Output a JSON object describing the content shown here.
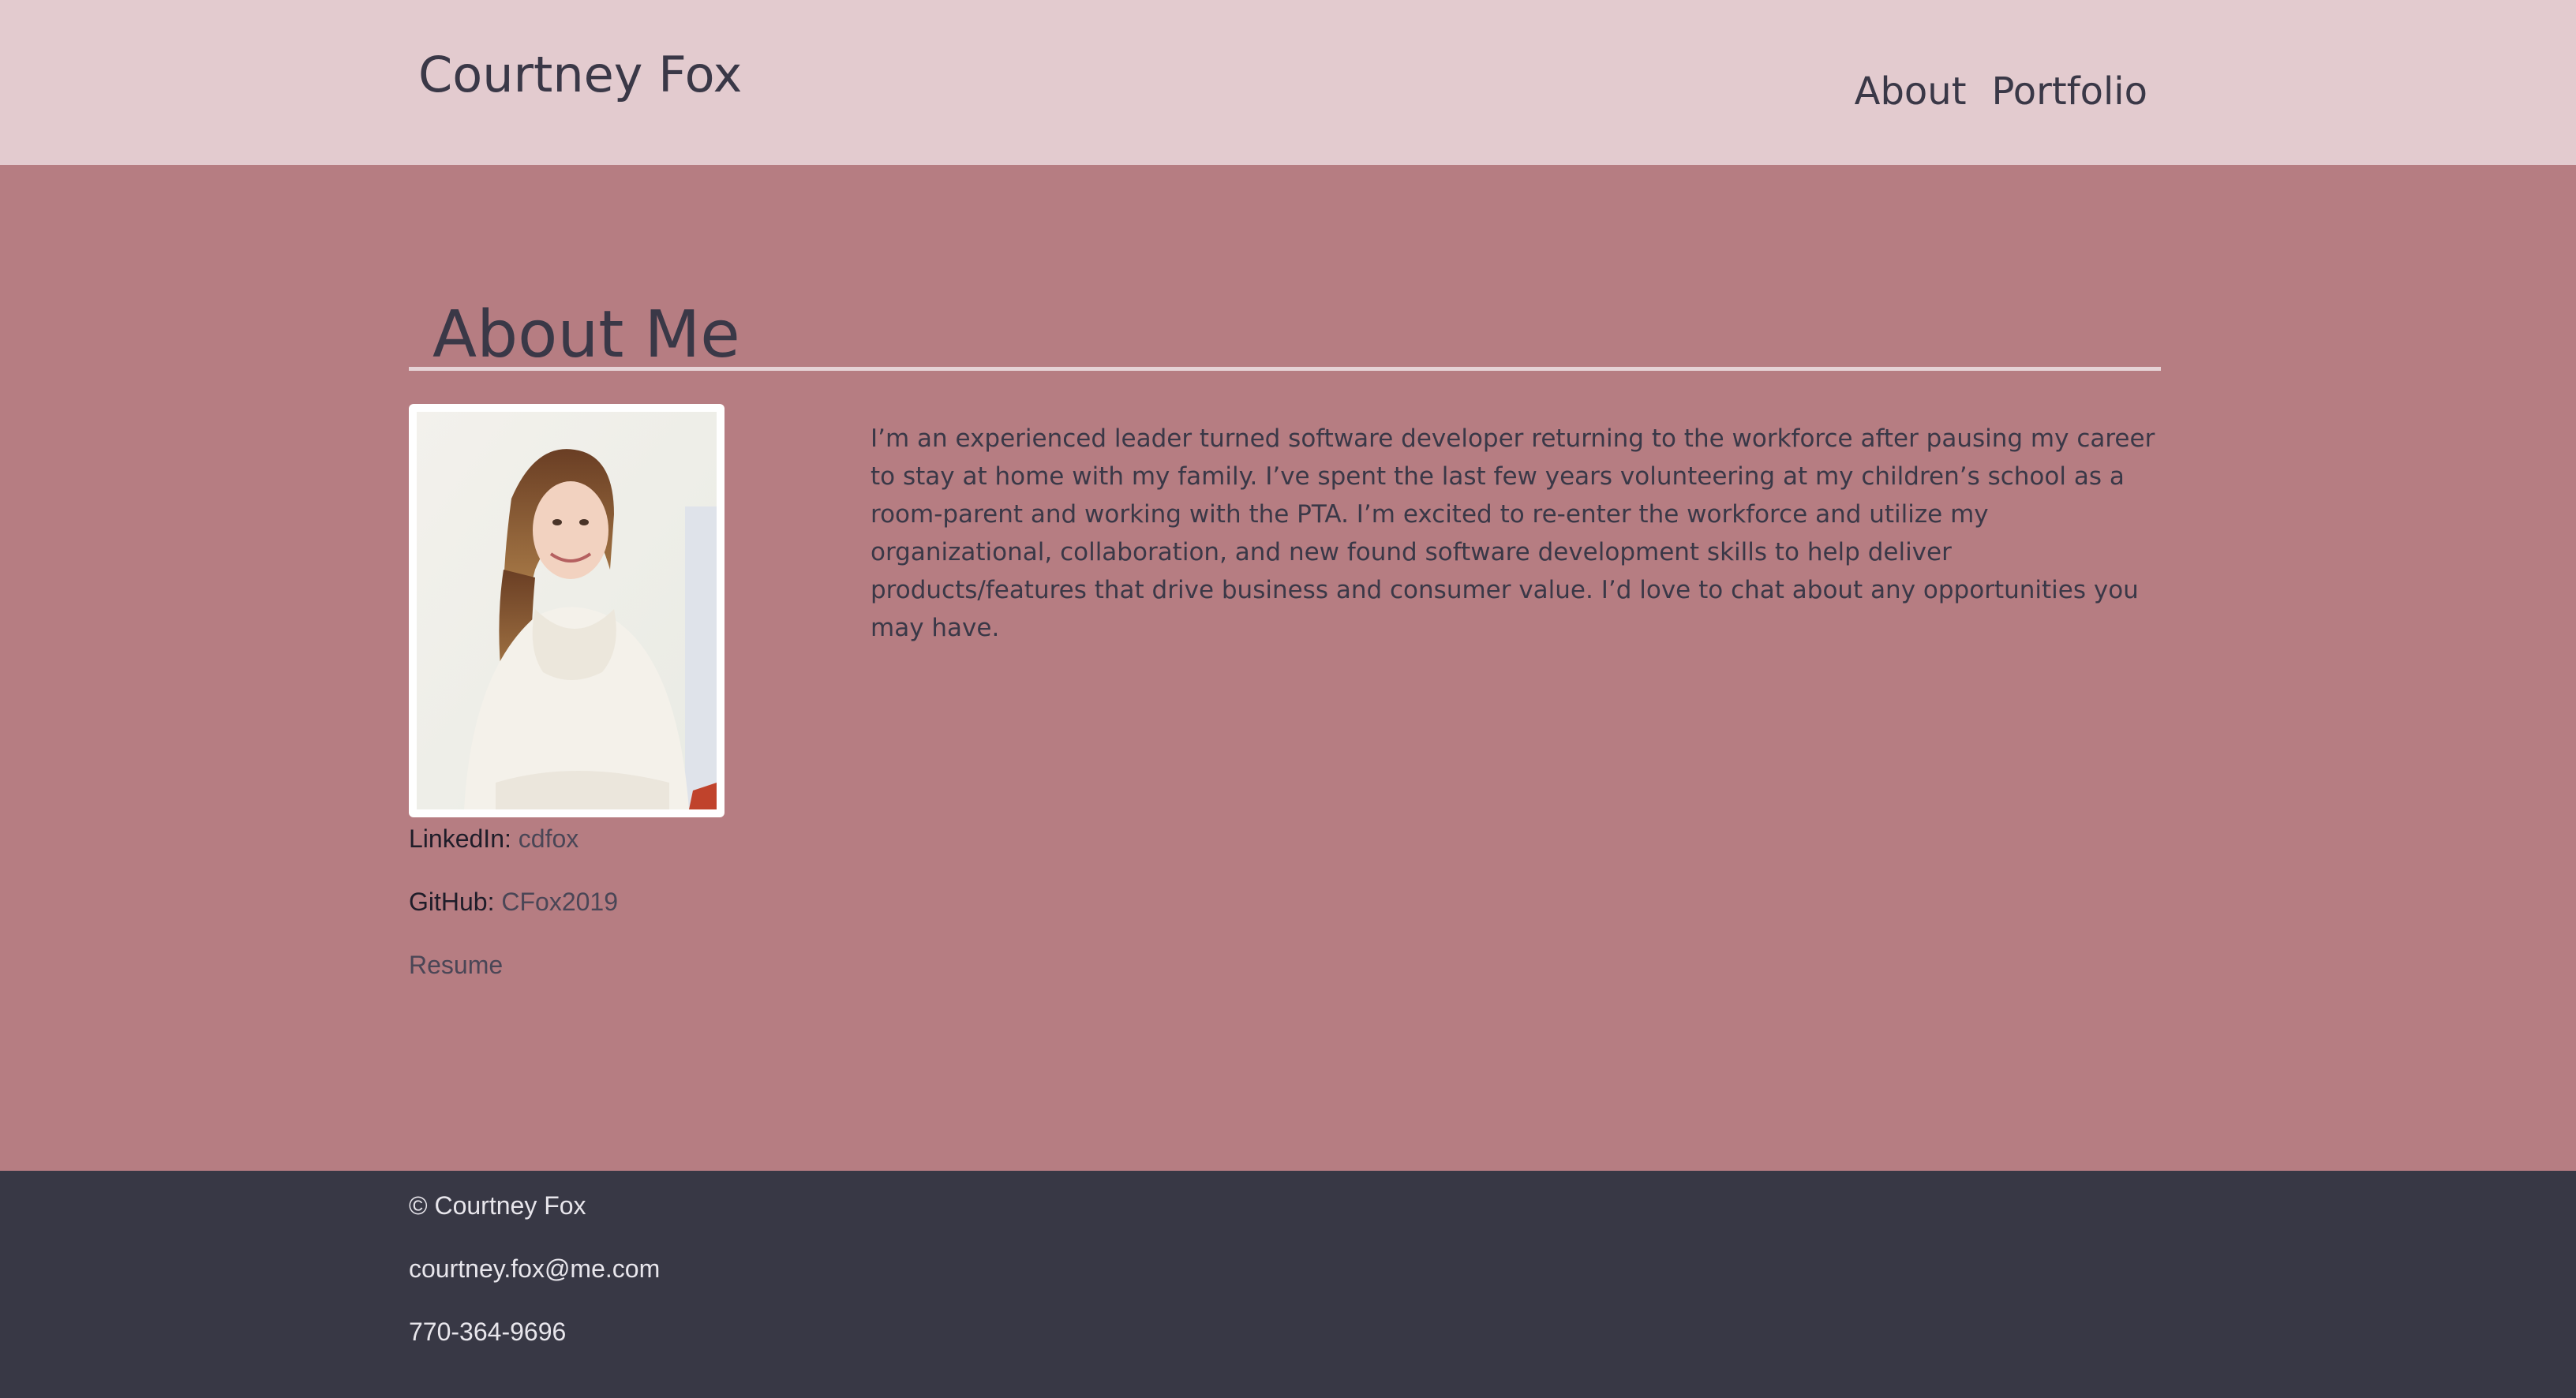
{
  "header": {
    "site_title": "Courtney Fox",
    "nav": [
      {
        "label": "About"
      },
      {
        "label": "Portfolio"
      }
    ]
  },
  "about": {
    "heading": "About Me",
    "bio": "I’m an experienced leader turned software developer returning to the workforce after pausing my career to stay at home with my family. I’ve spent the last few years volunteering at my children’s school as a room-parent and working with the PTA. I’m excited to re-enter the workforce and utilize my organizational, collaboration, and new found software development skills to help deliver products/features that drive business and consumer value. I’d love to chat about any opportunities you may have.",
    "links": {
      "linkedin_label": "LinkedIn:",
      "linkedin_value": "cdfox",
      "github_label": "GitHub:",
      "github_value": "CFox2019",
      "resume_label": "Resume"
    }
  },
  "footer": {
    "copyright": "© Courtney Fox",
    "email": "courtney.fox@me.com",
    "phone": "770-364-9696"
  },
  "colors": {
    "header_bg": "#e3cbcf",
    "main_bg": "#b67d82",
    "footer_bg": "#383845",
    "text_dark": "#3a3847"
  }
}
